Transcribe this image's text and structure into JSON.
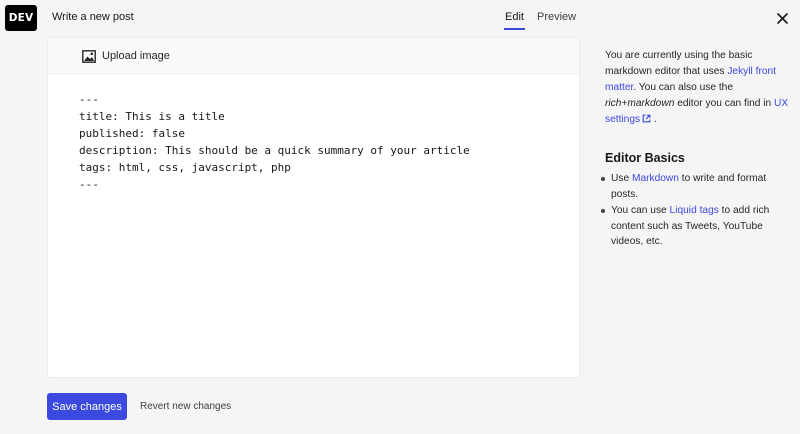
{
  "header": {
    "logo_text": "DEV",
    "title": "Write a new post",
    "tabs": [
      {
        "label": "Edit",
        "active": true
      },
      {
        "label": "Preview",
        "active": false
      }
    ],
    "close_icon": "close-icon"
  },
  "editor": {
    "toolbar": {
      "upload_icon": "image-icon",
      "upload_label": "Upload image"
    },
    "lines": [
      "---",
      "title: This is a title",
      "published: false",
      "description: This should be a quick summary of your article",
      "tags: html, css, javascript, php",
      "---"
    ]
  },
  "sidebar": {
    "intro_1": "You are currently using the basic markdown editor that uses ",
    "intro_link_1": "Jekyll front matter",
    "intro_2": ". You can also use the ",
    "intro_em": "rich+markdown",
    "intro_3": " editor you can find in ",
    "intro_link_2": "UX settings",
    "intro_4": " .",
    "heading": "Editor Basics",
    "tip_1_pre": "Use ",
    "tip_1_link": "Markdown",
    "tip_1_post": " to write and format posts.",
    "tip_2_pre": "You can use ",
    "tip_2_link": "Liquid tags",
    "tip_2_post": " to add rich content such as Tweets, YouTube videos, etc."
  },
  "footer": {
    "save_label": "Save changes",
    "revert_label": "Revert new changes"
  },
  "colors": {
    "accent": "#3b49df",
    "background": "#f5f5f5",
    "logo_bg": "#000000"
  }
}
